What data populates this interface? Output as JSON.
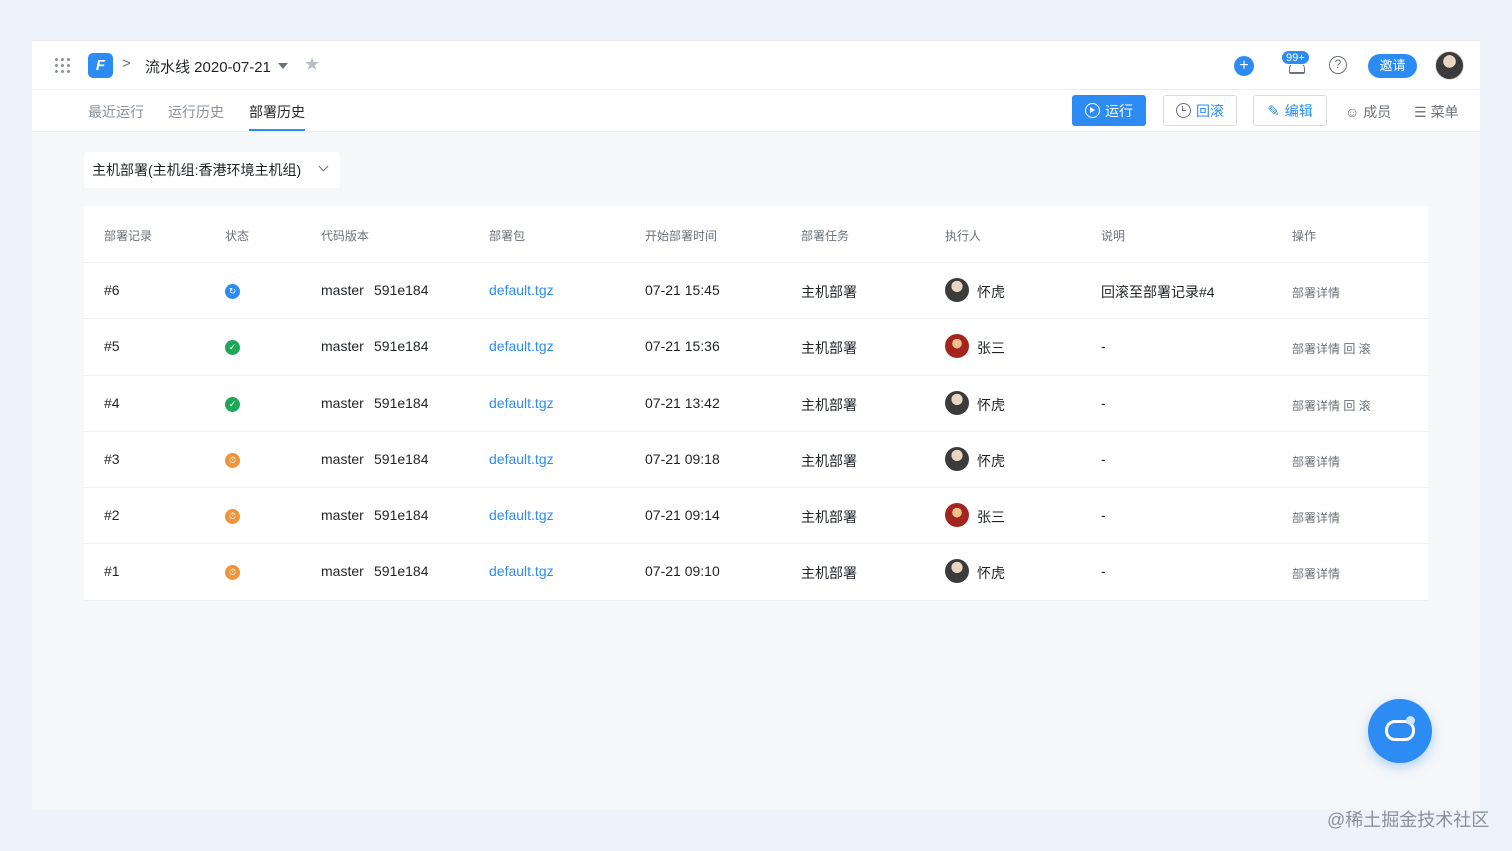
{
  "header": {
    "logo_letter": "F",
    "breadcrumb_sep": ">",
    "pipeline_title": "流水线 2020-07-21",
    "star": "★",
    "plus": "+",
    "notification_badge": "99+",
    "help": "?",
    "invite_label": "邀请"
  },
  "tabs": [
    {
      "label": "最近运行",
      "active": false
    },
    {
      "label": "运行历史",
      "active": false
    },
    {
      "label": "部署历史",
      "active": true
    }
  ],
  "actions": {
    "run": "运行",
    "rollback": "回滚",
    "edit": "编辑",
    "members": "成员",
    "menu": "菜单"
  },
  "filter": {
    "label": "主机部署(主机组:香港环境主机组)"
  },
  "table": {
    "headers": [
      "部署记录",
      "状态",
      "代码版本",
      "部署包",
      "开始部署时间",
      "部署任务",
      "执行人",
      "说明",
      "操作"
    ],
    "rows": [
      {
        "id": "#6",
        "status": "running",
        "branch": "master",
        "commit": "591e184",
        "package": "default.tgz",
        "time": "07-21 15:45",
        "task": "主机部署",
        "user": "怀虎",
        "note": "回滚至部署记录#4",
        "ops": "部署详情"
      },
      {
        "id": "#5",
        "status": "success",
        "branch": "master",
        "commit": "591e184",
        "package": "default.tgz",
        "time": "07-21 15:36",
        "task": "主机部署",
        "user": "张三",
        "note": "-",
        "ops": "部署详情 回 滚"
      },
      {
        "id": "#4",
        "status": "success",
        "branch": "master",
        "commit": "591e184",
        "package": "default.tgz",
        "time": "07-21 13:42",
        "task": "主机部署",
        "user": "怀虎",
        "note": "-",
        "ops": "部署详情 回 滚"
      },
      {
        "id": "#3",
        "status": "waiting",
        "branch": "master",
        "commit": "591e184",
        "package": "default.tgz",
        "time": "07-21 09:18",
        "task": "主机部署",
        "user": "怀虎",
        "note": "-",
        "ops": "部署详情"
      },
      {
        "id": "#2",
        "status": "waiting",
        "branch": "master",
        "commit": "591e184",
        "package": "default.tgz",
        "time": "07-21 09:14",
        "task": "主机部署",
        "user": "张三",
        "note": "-",
        "ops": "部署详情"
      },
      {
        "id": "#1",
        "status": "waiting",
        "branch": "master",
        "commit": "591e184",
        "package": "default.tgz",
        "time": "07-21 09:10",
        "task": "主机部署",
        "user": "怀虎",
        "note": "-",
        "ops": "部署详情"
      }
    ]
  },
  "status_colors": {
    "running": "#2c8cf4",
    "success": "#1ea75b",
    "waiting": "#f0943a"
  },
  "watermark": "@稀土掘金技术社区"
}
